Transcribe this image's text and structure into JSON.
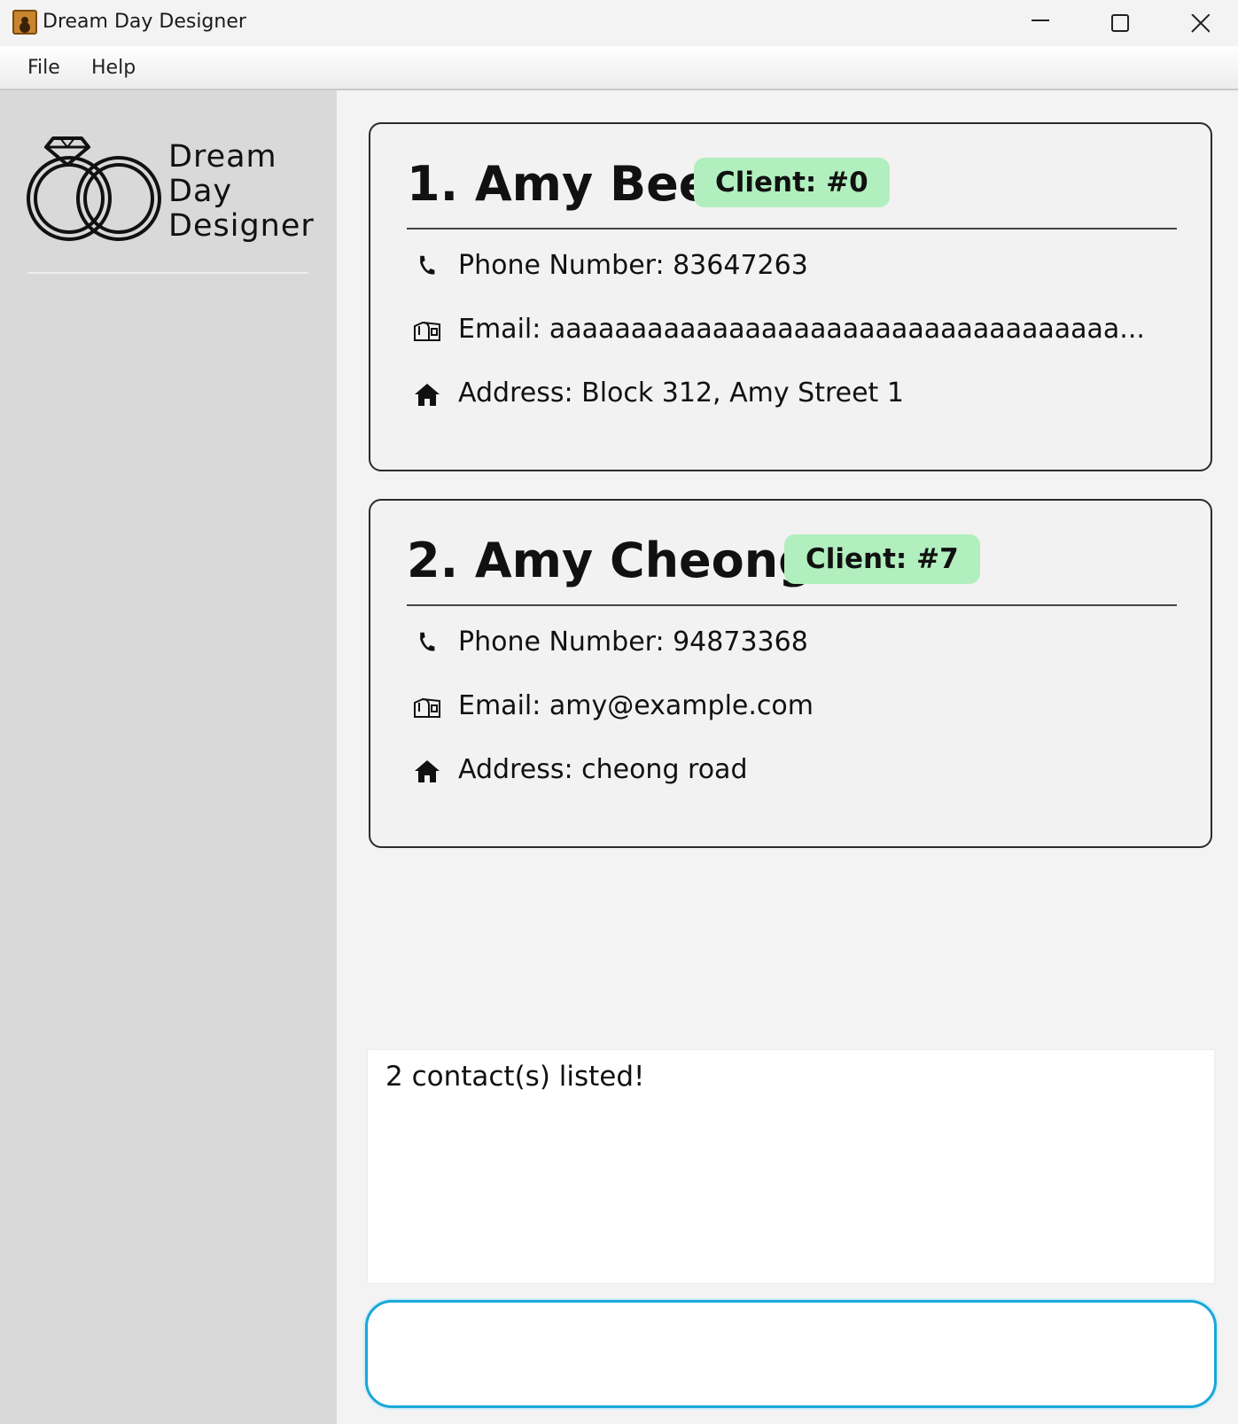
{
  "window": {
    "title": "Dream Day Designer",
    "icons": {
      "app": "app-icon",
      "minimize": "minimize-icon",
      "maximize": "maximize-icon",
      "close": "close-icon"
    }
  },
  "menu": {
    "items": [
      {
        "label": "File"
      },
      {
        "label": "Help"
      }
    ]
  },
  "sidebar": {
    "logo_lines": [
      "Dream",
      "Day",
      "Designer"
    ],
    "logo_icon": "wedding-rings-icon"
  },
  "contacts": [
    {
      "name": "1. Amy Bee",
      "badge": "Client: #0",
      "phone": "Phone Number: 83647263",
      "email": "Email: aaaaaaaaaaaaaaaaaaaaaaaaaaaaaaaaaaa...",
      "address": "Address: Block 312, Amy Street 1"
    },
    {
      "name": "2. Amy Cheong",
      "badge": "Client: #7",
      "phone": "Phone Number: 94873368",
      "email": "Email: amy@example.com",
      "address": "Address: cheong road"
    }
  ],
  "result": {
    "text": "2 contact(s) listed!"
  },
  "command": {
    "value": "",
    "placeholder": ""
  },
  "colors": {
    "badge": "#b1efbe",
    "accent": "#1aa6d8",
    "sidebar": "#d9d9d9"
  }
}
